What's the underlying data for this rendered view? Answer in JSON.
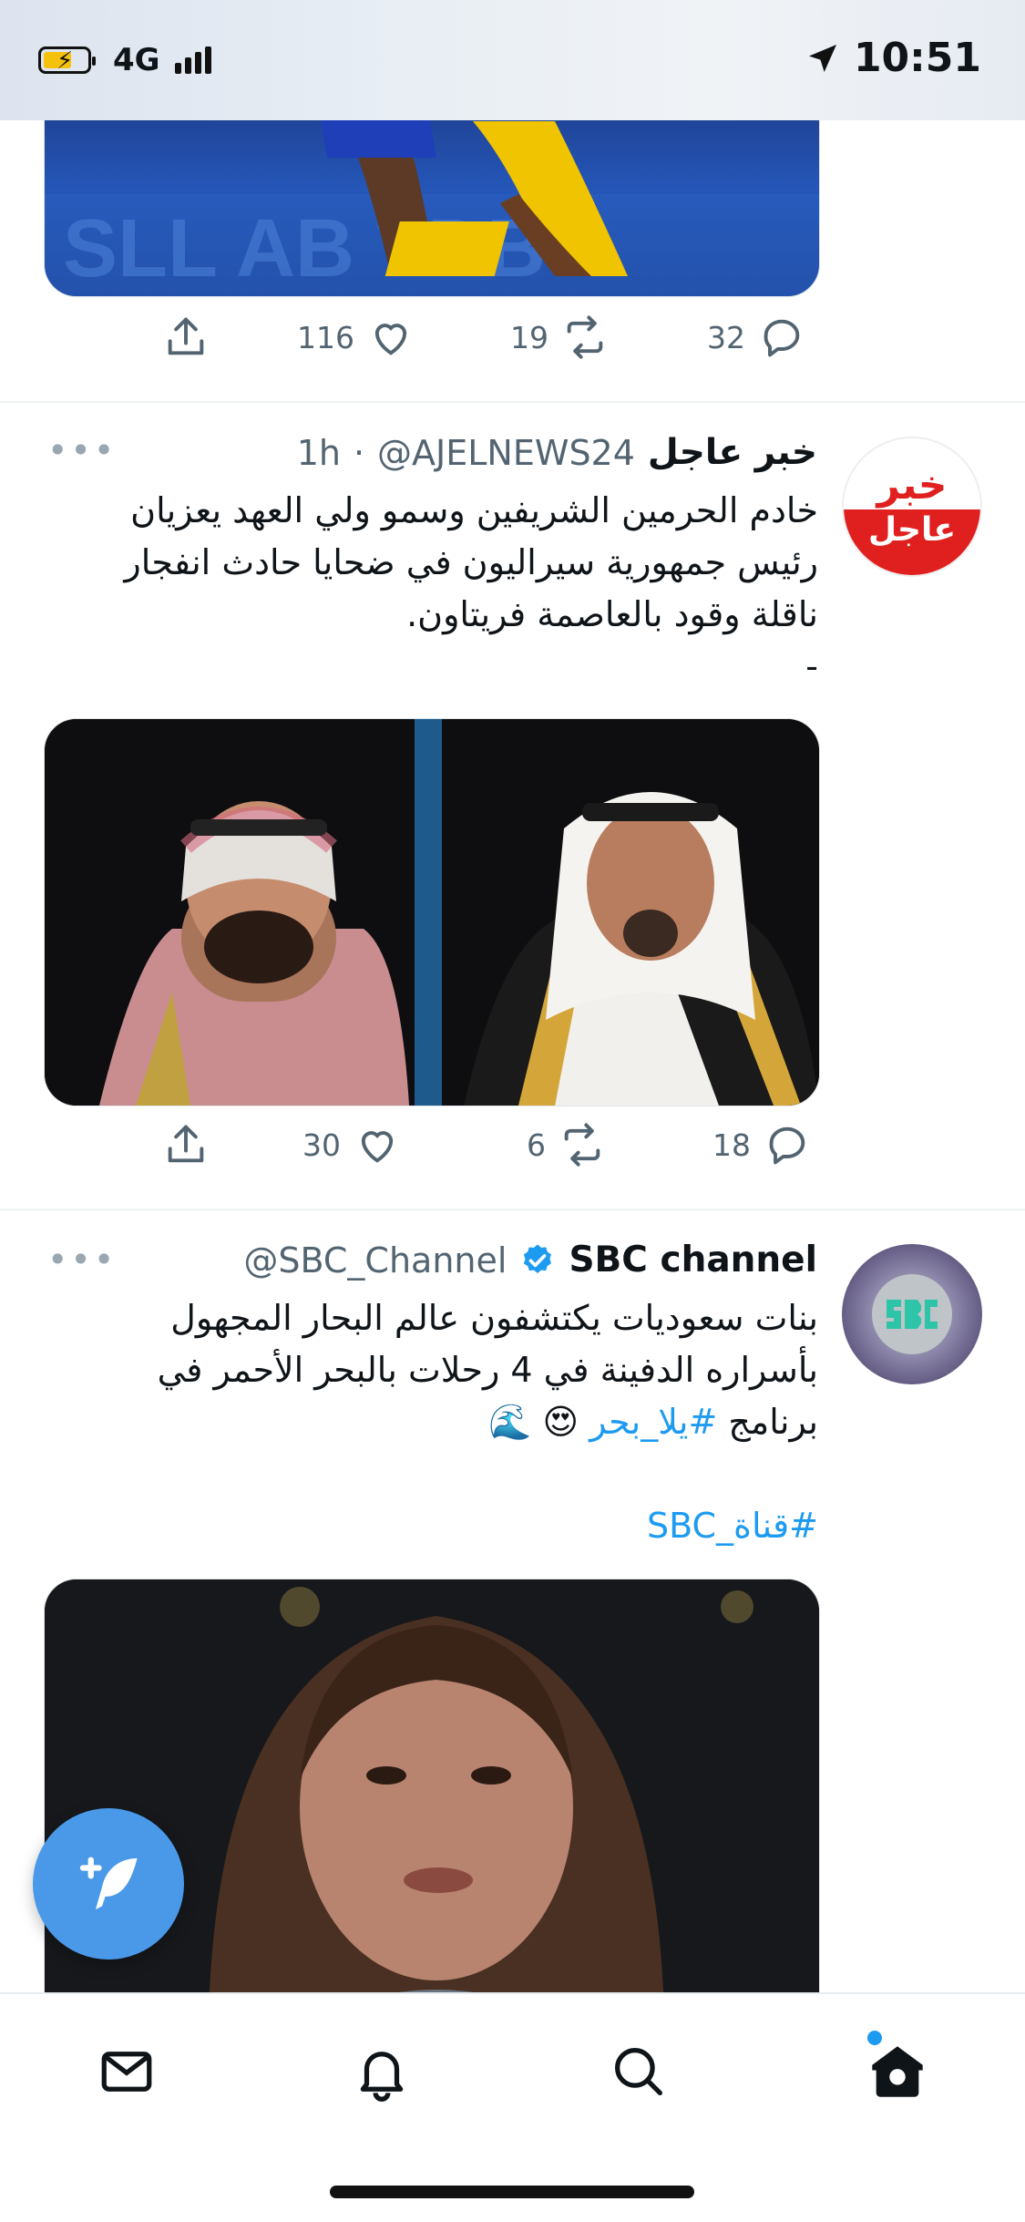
{
  "status_bar": {
    "network": "4G",
    "time": "10:51",
    "battery_color": "#f4c20d"
  },
  "tweets": [
    {
      "counts": {
        "replies": "32",
        "retweets": "19",
        "likes": "116"
      }
    },
    {
      "name": "خبر عاجل",
      "handle": "@AJELNEWS24",
      "time": "1h",
      "avatar_text_top": "خبر",
      "avatar_text_bottom": "عاجل",
      "text_lines": [
        "خادم الحرمين الشريفين وسمو ولي العهد يعزيان",
        "رئيس جمهورية سيراليون في ضحايا حادث انفجار",
        "ناقلة وقود بالعاصمة فريتاون.",
        "-"
      ],
      "counts": {
        "replies": "18",
        "retweets": "6",
        "likes": "30"
      }
    },
    {
      "name": "SBC channel",
      "handle": "@SBC_Channel",
      "verified": true,
      "text_lines": [
        "بنات سعوديات يكتشفون عالم البحار المجهول",
        "بأسراره الدفينة في 4 رحلات بالبحر الأحمر في"
      ],
      "text_line3_prefix": "برنامج ",
      "text_line3_hashtag": "#يلا_بحر",
      "text_line3_emoji": "😍 🌊",
      "hashtag2": "#قناة_SBC"
    }
  ],
  "icons": [
    "share-icon",
    "like-icon",
    "retweet-icon",
    "reply-icon",
    "compose-icon",
    "mail-icon",
    "bell-icon",
    "search-icon",
    "home-icon"
  ],
  "colors": {
    "accent": "#1d9bf0",
    "fab": "#4a99e9",
    "meta": "#536471"
  }
}
